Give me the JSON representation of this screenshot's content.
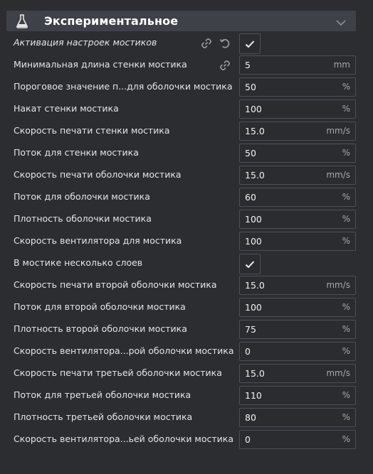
{
  "section": {
    "title": "Экспериментальное",
    "icon": "flask-icon",
    "collapse_icon": "chevron-down-icon"
  },
  "settings": [
    {
      "label": "Активация настроек мостиков",
      "type": "checkbox",
      "checked": true,
      "italic": true,
      "link_icon": true,
      "reset_icon": true
    },
    {
      "label": "Минимальная длина стенки мостика",
      "type": "input",
      "value": "5",
      "unit": "mm",
      "link_icon": true
    },
    {
      "label": "Пороговое значение п...для оболочки мостика",
      "type": "input",
      "value": "50",
      "unit": "%"
    },
    {
      "label": "Накат стенки мостика",
      "type": "input",
      "value": "100",
      "unit": "%"
    },
    {
      "label": "Скорость печати стенки мостика",
      "type": "input",
      "value": "15.0",
      "unit": "mm/s"
    },
    {
      "label": "Поток для стенки мостика",
      "type": "input",
      "value": "50",
      "unit": "%"
    },
    {
      "label": "Скорость печати оболочки мостика",
      "type": "input",
      "value": "15.0",
      "unit": "mm/s"
    },
    {
      "label": "Поток для оболочки мостика",
      "type": "input",
      "value": "60",
      "unit": "%"
    },
    {
      "label": "Плотность оболочки мостика",
      "type": "input",
      "value": "100",
      "unit": "%"
    },
    {
      "label": "Скорость вентилятора для мостика",
      "type": "input",
      "value": "100",
      "unit": "%"
    },
    {
      "label": "В мостике несколько слоев",
      "type": "checkbox",
      "checked": true
    },
    {
      "label": "Скорость печати второй оболочки мостика",
      "type": "input",
      "value": "15.0",
      "unit": "mm/s"
    },
    {
      "label": "Поток для второй оболочки мостика",
      "type": "input",
      "value": "100",
      "unit": "%"
    },
    {
      "label": "Плотность второй оболочки мостика",
      "type": "input",
      "value": "75",
      "unit": "%"
    },
    {
      "label": "Скорость вентилятора...рой оболочки мостика",
      "type": "input",
      "value": "0",
      "unit": "%"
    },
    {
      "label": "Скорость печати третьей оболочки мостика",
      "type": "input",
      "value": "15.0",
      "unit": "mm/s"
    },
    {
      "label": "Поток для третьей оболочки мостика",
      "type": "input",
      "value": "110",
      "unit": "%"
    },
    {
      "label": "Плотность третьей оболочки мостика",
      "type": "input",
      "value": "80",
      "unit": "%"
    },
    {
      "label": "Скорость вентилятора...ьей оболочки мостика",
      "type": "input",
      "value": "0",
      "unit": "%"
    }
  ],
  "colors": {
    "background": "#2b2d31",
    "header": "#3e4147",
    "field_border": "#4c4f56",
    "text": "#e4e5e7",
    "unit": "#a6a8ad"
  }
}
